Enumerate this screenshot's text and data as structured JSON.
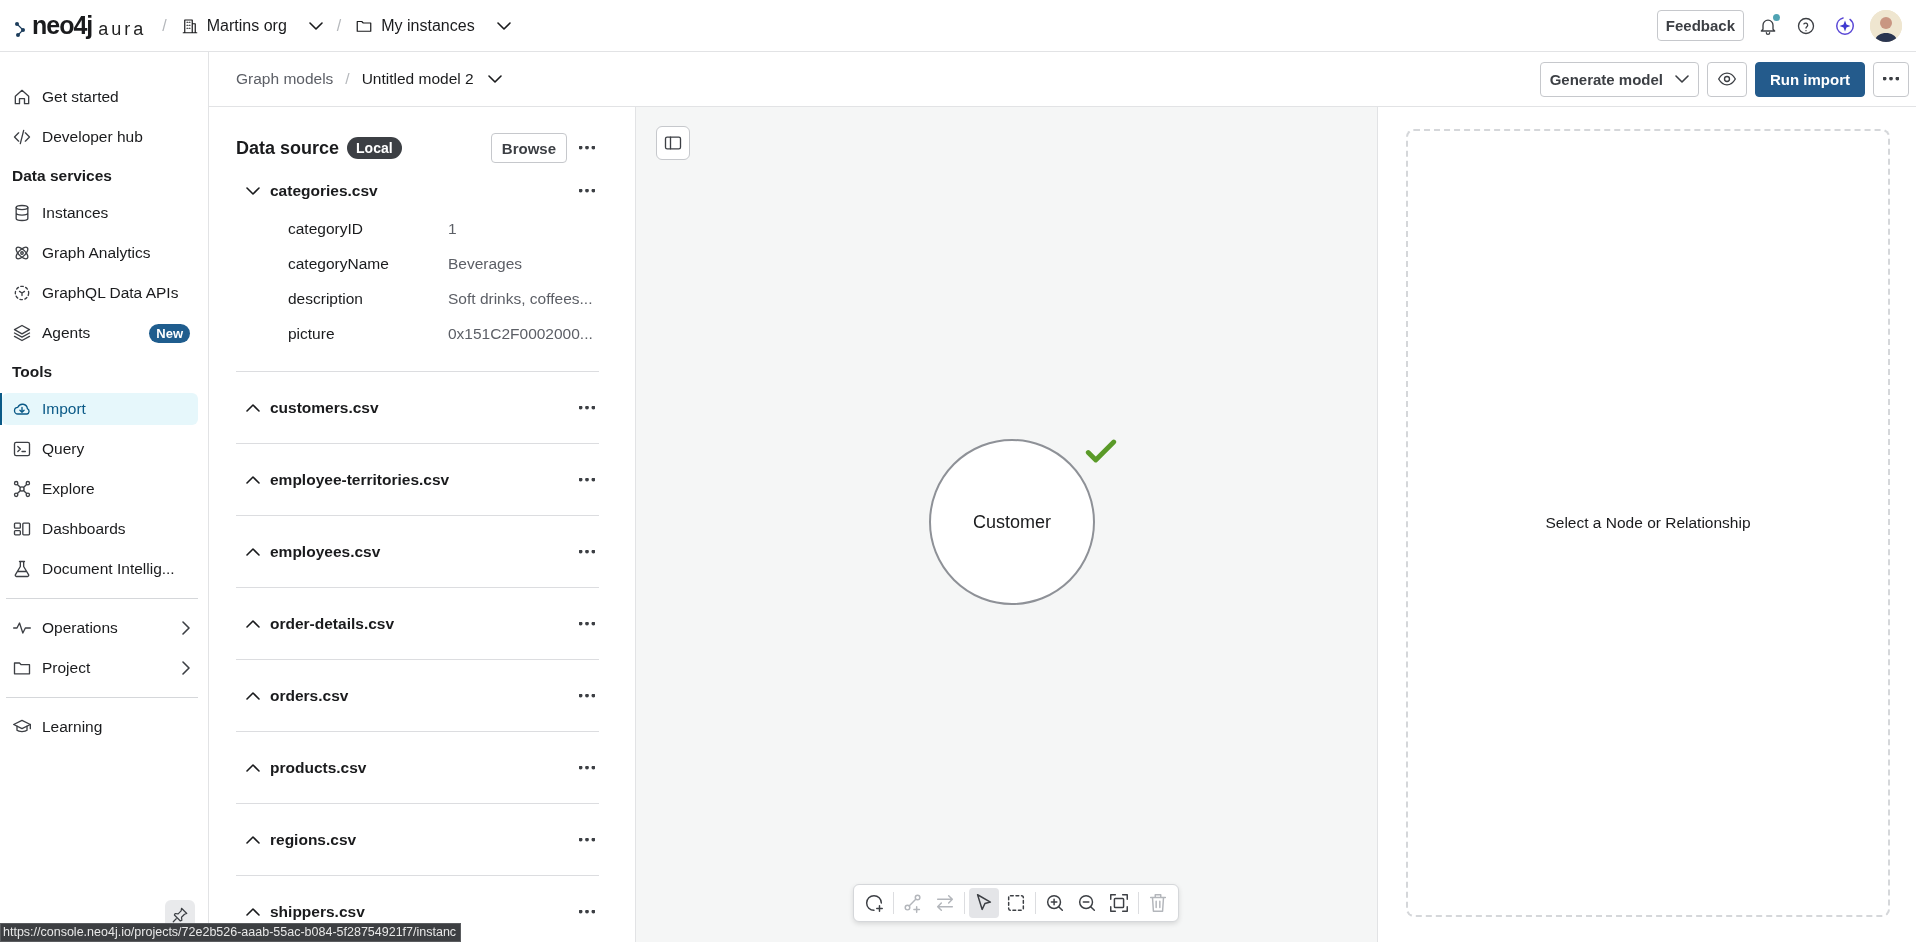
{
  "topbar": {
    "logo": {
      "brand": "neo4j",
      "product": "aura"
    },
    "separator": "/",
    "breadcrumbs": [
      {
        "label": "Martins org"
      },
      {
        "label": "My instances"
      }
    ],
    "feedback": "Feedback",
    "notifications_unread": true
  },
  "sidebar": {
    "sections": [
      {
        "divided": false,
        "items": [
          {
            "label": "Get started",
            "selected": false,
            "submenu": false
          },
          {
            "label": "Developer hub",
            "selected": false,
            "submenu": false
          }
        ]
      },
      {
        "divided": false,
        "heading": "Data services",
        "items": [
          {
            "label": "Instances",
            "selected": false,
            "submenu": false
          },
          {
            "label": "Graph Analytics",
            "selected": false,
            "submenu": false
          },
          {
            "label": "GraphQL Data APIs",
            "selected": false,
            "submenu": false
          },
          {
            "label": "Agents",
            "selected": false,
            "submenu": false,
            "badge": "New"
          }
        ]
      },
      {
        "divided": false,
        "heading": "Tools",
        "items": [
          {
            "label": "Import",
            "selected": true,
            "submenu": false
          },
          {
            "label": "Query",
            "selected": false,
            "submenu": false
          },
          {
            "label": "Explore",
            "selected": false,
            "submenu": false
          },
          {
            "label": "Dashboards",
            "selected": false,
            "submenu": false
          },
          {
            "label": "Document Intellig...",
            "selected": false,
            "submenu": false
          }
        ]
      },
      {
        "divided": true,
        "items": [
          {
            "label": "Operations",
            "selected": false,
            "submenu": true
          },
          {
            "label": "Project",
            "selected": false,
            "submenu": true
          }
        ]
      },
      {
        "divided": true,
        "items": [
          {
            "label": "Learning",
            "selected": false,
            "submenu": false
          }
        ]
      }
    ]
  },
  "header": {
    "breadcrumbs": [
      {
        "label": "Graph models"
      },
      {
        "label": "Untitled model 2"
      }
    ],
    "separator": "/",
    "generate": "Generate model",
    "run": "Run import"
  },
  "data_source": {
    "title": "Data source",
    "badge": "Local",
    "browse": "Browse",
    "files": [
      {
        "name": "categories.csv",
        "expanded": true,
        "fields": [
          {
            "name": "categoryID",
            "value": "1"
          },
          {
            "name": "categoryName",
            "value": "Beverages"
          },
          {
            "name": "description",
            "value": "Soft drinks, coffees..."
          },
          {
            "name": "picture",
            "value": "0x151C2F0002000..."
          }
        ]
      },
      {
        "name": "customers.csv",
        "expanded": false
      },
      {
        "name": "employee-territories.csv",
        "expanded": false
      },
      {
        "name": "employees.csv",
        "expanded": false
      },
      {
        "name": "order-details.csv",
        "expanded": false
      },
      {
        "name": "orders.csv",
        "expanded": false
      },
      {
        "name": "products.csv",
        "expanded": false
      },
      {
        "name": "regions.csv",
        "expanded": false
      },
      {
        "name": "shippers.csv",
        "expanded": false
      }
    ]
  },
  "canvas": {
    "nodes": [
      {
        "label": "Customer",
        "valid": true
      }
    ],
    "tools": [
      {
        "selected": false,
        "disabled": false
      },
      {
        "selected": false,
        "disabled": true
      },
      {
        "selected": false,
        "disabled": true
      },
      {
        "selected": true,
        "disabled": false
      },
      {
        "selected": false,
        "disabled": false
      },
      {
        "selected": false,
        "disabled": false
      },
      {
        "selected": false,
        "disabled": false
      },
      {
        "selected": false,
        "disabled": false
      },
      {
        "selected": false,
        "disabled": true
      }
    ]
  },
  "details": {
    "empty_message": "Select a Node or Relationship"
  },
  "status_bar": {
    "url": "https://console.neo4j.io/projects/72e2b526-aaab-55ac-b084-5f28754921f7/instanc"
  }
}
